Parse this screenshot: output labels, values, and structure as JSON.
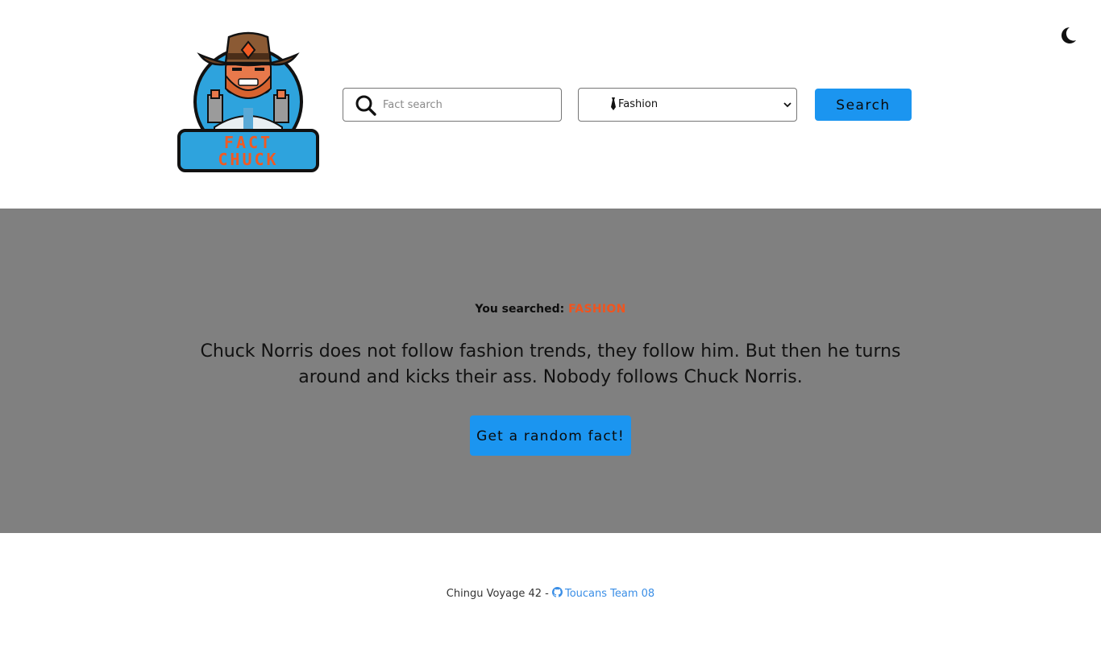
{
  "header": {
    "logo_text_line1": "FACT",
    "logo_text_line2": "CHUCK",
    "theme_toggle_icon": "moon-icon",
    "search": {
      "placeholder": "Fact search",
      "value": "",
      "icon": "search-icon"
    },
    "category_select": {
      "selected": "Fashion",
      "icon": "tie-icon"
    },
    "search_button_label": "Search"
  },
  "main": {
    "searched_label": "You searched:",
    "searched_term": "FASHION",
    "fact": "Chuck Norris does not follow fashion trends, they follow him. But then he turns around and kicks their ass. Nobody follows Chuck Norris.",
    "random_button_label": "Get a random fact!"
  },
  "footer": {
    "prefix": "Chingu Voyage 42 -",
    "link_label": "Toucans Team 08",
    "link_icon": "github-icon"
  },
  "colors": {
    "accent_blue": "#1b95f0",
    "main_background": "#808080",
    "search_term_orange": "#f0541e",
    "footer_link": "#3a8ee6"
  }
}
